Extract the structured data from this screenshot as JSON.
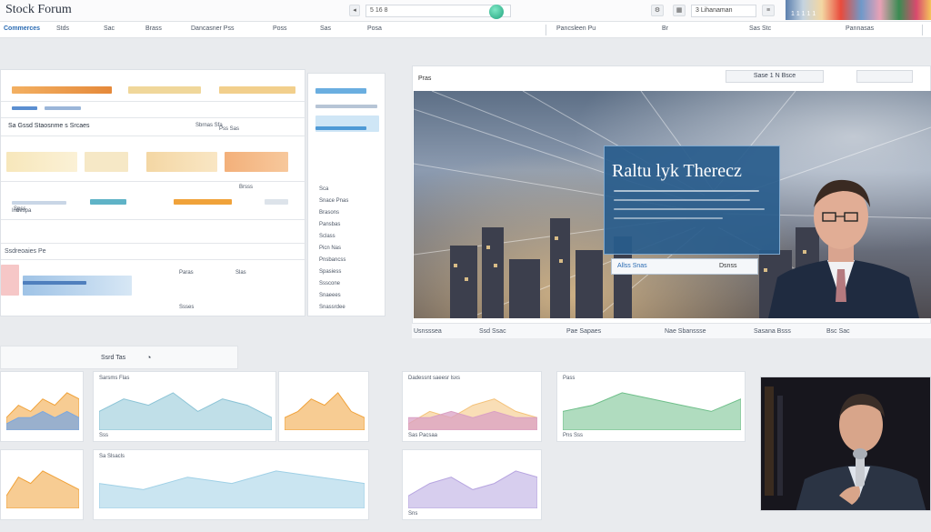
{
  "app": {
    "title": "Stock Forum"
  },
  "topbar": {
    "search_value": "5 16 8",
    "right_field": "3 Lihanaman",
    "right_label": "1 1 1 1 1"
  },
  "nav": {
    "items": [
      {
        "label": "Commerces",
        "active": true
      },
      {
        "label": "Stds"
      },
      {
        "label": "Sac"
      },
      {
        "label": "Brass"
      },
      {
        "label": "Dancasner Pss"
      },
      {
        "label": "Poss"
      },
      {
        "label": "Sas"
      },
      {
        "label": "Posa"
      },
      {
        "label": "Pancsleen Pu"
      },
      {
        "label": "Br"
      },
      {
        "label": "Sas Stc"
      },
      {
        "label": "Pannasas"
      }
    ]
  },
  "left_panel": {
    "section_title": "Sa Gssd Staosnme s Srcaes",
    "section_subtitle": "Sbrnas Sfa",
    "row_labels": [
      "Indespa",
      "Brsss",
      "Pss Sas",
      "Spss"
    ],
    "footer_label": "Ssdreoaies Pe",
    "bottom_labels": [
      "Paras",
      "Slas",
      "Ssses"
    ]
  },
  "side_list": {
    "items": [
      "Sca",
      "Snace Pnas",
      "Brasons",
      "Pansbas",
      "Sclass",
      "Picn Nas",
      "Pnsbancss",
      "Spasiess",
      "Ssscone",
      "Snaeees",
      "Snassrdee"
    ]
  },
  "video": {
    "header_label": "Pras",
    "header_button": "Sase 1 N Bsce",
    "slide_title": "Raltu lyk Therecz",
    "slide_button": "Allss Snas",
    "slide_button_right": "Dsnss",
    "caption_items": [
      "Usnsssea",
      "Ssd Ssac",
      "Pae Sapaes",
      "Nae Sbanssse",
      "Sasana Bsss",
      "Bsc Sac"
    ]
  },
  "bottom": {
    "section_label": "Ssrd Tas",
    "card_titles": [
      "Sarsms Flas",
      "Sa Slsacls",
      "Dadessnt saeesr lsxs",
      "Pass"
    ],
    "card_footers": [
      "Sss",
      "Sns",
      "Sas Pacsaa",
      "Pns Sss"
    ]
  },
  "chart_data": [
    {
      "type": "area",
      "series": [
        {
          "values": [
            2,
            4,
            3,
            5,
            4,
            6,
            5
          ]
        },
        {
          "values": [
            1,
            2,
            2,
            3,
            2,
            3,
            2
          ]
        }
      ]
    },
    {
      "type": "area",
      "series": [
        {
          "values": [
            3,
            5,
            4,
            6,
            3,
            5,
            4,
            2
          ]
        }
      ]
    },
    {
      "type": "area",
      "series": [
        {
          "values": [
            2,
            3,
            5,
            4,
            6,
            3,
            2
          ]
        }
      ]
    },
    {
      "type": "area",
      "series": [
        {
          "values": [
            1,
            3,
            2,
            4,
            5,
            3,
            2
          ]
        },
        {
          "values": [
            2,
            2,
            3,
            2,
            3,
            2,
            2
          ]
        }
      ]
    },
    {
      "type": "area",
      "series": [
        {
          "values": [
            3,
            4,
            6,
            5,
            4,
            3,
            5
          ]
        }
      ]
    },
    {
      "type": "area",
      "series": [
        {
          "values": [
            2,
            5,
            4,
            6,
            5,
            4,
            3
          ]
        }
      ]
    },
    {
      "type": "area",
      "series": [
        {
          "values": [
            4,
            3,
            5,
            4,
            6,
            5,
            4
          ]
        }
      ]
    },
    {
      "type": "area",
      "series": [
        {
          "values": [
            2,
            4,
            5,
            3,
            4,
            6,
            5
          ]
        }
      ]
    }
  ],
  "colors": {
    "accent": "#2a6bb3",
    "orange": "#f0a23a",
    "teal": "#5fb3c7",
    "slide": "#285c8c"
  }
}
